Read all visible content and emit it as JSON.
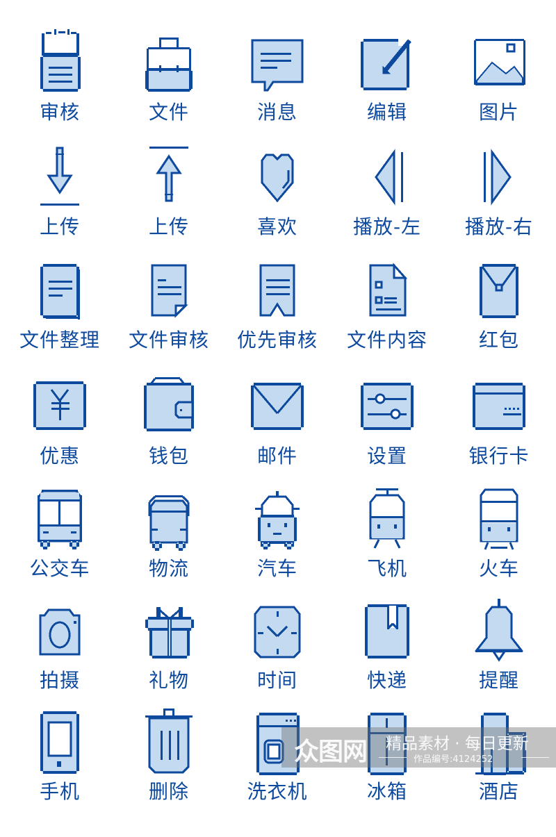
{
  "colors": {
    "stroke": "#0d4a9e",
    "fill": "#c3daf0",
    "label": "#0d4a9e",
    "background": "#ffffff"
  },
  "icons": [
    {
      "name": "review-icon",
      "label": "审核"
    },
    {
      "name": "briefcase-icon",
      "label": "文件"
    },
    {
      "name": "message-icon",
      "label": "消息"
    },
    {
      "name": "edit-icon",
      "label": "编辑"
    },
    {
      "name": "image-icon",
      "label": "图片"
    },
    {
      "name": "download-icon",
      "label": "上传"
    },
    {
      "name": "upload-icon",
      "label": "上传"
    },
    {
      "name": "heart-icon",
      "label": "喜欢"
    },
    {
      "name": "play-left-icon",
      "label": "播放-左"
    },
    {
      "name": "play-right-icon",
      "label": "播放-右"
    },
    {
      "name": "documents-stack-icon",
      "label": "文件整理"
    },
    {
      "name": "document-fold-icon",
      "label": "文件审核"
    },
    {
      "name": "bookmark-doc-icon",
      "label": "优先审核"
    },
    {
      "name": "document-content-icon",
      "label": "文件内容"
    },
    {
      "name": "red-envelope-icon",
      "label": "红包"
    },
    {
      "name": "yen-coupon-icon",
      "label": "优惠"
    },
    {
      "name": "wallet-icon",
      "label": "钱包"
    },
    {
      "name": "mail-icon",
      "label": "邮件"
    },
    {
      "name": "settings-sliders-icon",
      "label": "设置"
    },
    {
      "name": "bank-card-icon",
      "label": "银行卡"
    },
    {
      "name": "bus-icon",
      "label": "公交车"
    },
    {
      "name": "truck-icon",
      "label": "物流"
    },
    {
      "name": "car-icon",
      "label": "汽车"
    },
    {
      "name": "tram-icon",
      "label": "飞机"
    },
    {
      "name": "train-icon",
      "label": "火车"
    },
    {
      "name": "camera-icon",
      "label": "拍摄"
    },
    {
      "name": "gift-icon",
      "label": "礼物"
    },
    {
      "name": "clock-icon",
      "label": "时间"
    },
    {
      "name": "package-icon",
      "label": "快递"
    },
    {
      "name": "bell-icon",
      "label": "提醒"
    },
    {
      "name": "phone-icon",
      "label": "手机"
    },
    {
      "name": "trash-icon",
      "label": "删除"
    },
    {
      "name": "washing-machine-icon",
      "label": "洗衣机"
    },
    {
      "name": "fridge-icon",
      "label": "冰箱"
    },
    {
      "name": "hotel-icon",
      "label": "酒店"
    }
  ],
  "watermark": {
    "logo": "众图网",
    "slogan": "精品素材 · 每日更新",
    "work_id": "作品编号:4124252"
  }
}
